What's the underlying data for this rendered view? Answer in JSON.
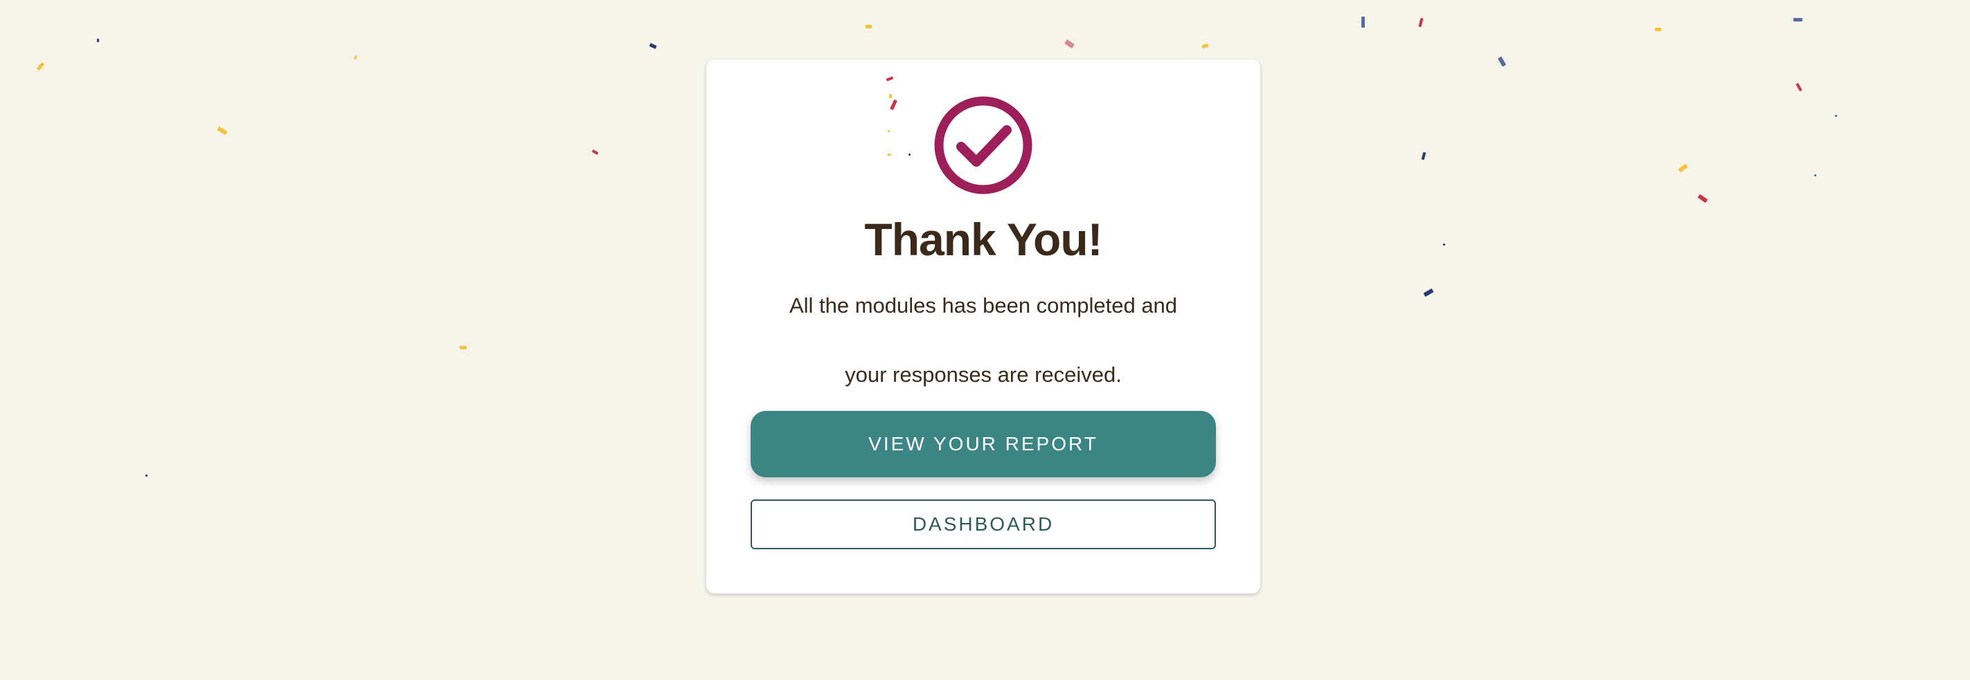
{
  "card": {
    "icon": "check-circle-icon",
    "title": "Thank You!",
    "message_line1": "All the modules has been completed and",
    "message_line2": "your responses are received.",
    "primary_button_label": "VIEW YOUR REPORT",
    "secondary_button_label": "DASHBOARD"
  },
  "colors": {
    "background": "#f4f4e8",
    "accent": "#9c1f5a",
    "primary_button": "#3b8585",
    "text": "#3b2a1a"
  }
}
